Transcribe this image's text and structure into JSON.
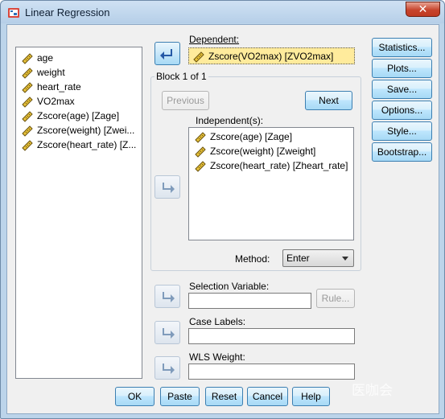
{
  "window": {
    "title": "Linear Regression",
    "close_label": "✕"
  },
  "source_list": {
    "items": [
      "age",
      "weight",
      "heart_rate",
      "VO2max",
      "Zscore(age) [Zage]",
      "Zscore(weight) [Zwei...",
      "Zscore(heart_rate) [Z..."
    ]
  },
  "dependent": {
    "label": "Dependent:",
    "value": "Zscore(VO2max) [ZVO2max]"
  },
  "block": {
    "label": "Block 1 of 1",
    "previous_label": "Previous",
    "next_label": "Next",
    "independents_label": "Independent(s):",
    "independents": [
      "Zscore(age) [Zage]",
      "Zscore(weight) [Zweight]",
      "Zscore(heart_rate) [Zheart_rate]"
    ],
    "method_label": "Method:",
    "method_value": "Enter"
  },
  "selection_variable": {
    "label": "Selection Variable:",
    "value": "",
    "rule_label": "Rule..."
  },
  "case_labels": {
    "label": "Case Labels:",
    "value": ""
  },
  "wls_weight": {
    "label": "WLS Weight:",
    "value": ""
  },
  "side_buttons": [
    "Statistics...",
    "Plots...",
    "Save...",
    "Options...",
    "Style...",
    "Bootstrap..."
  ],
  "bottom_buttons": [
    "OK",
    "Paste",
    "Reset",
    "Cancel",
    "Help"
  ],
  "watermark": "医咖会",
  "colors": {
    "window_frame": "#bcd4ea",
    "dialog_bg": "#f0f0f0",
    "highlight_field": "#ffeb9c",
    "accent_blue": "#3c7fb1"
  }
}
